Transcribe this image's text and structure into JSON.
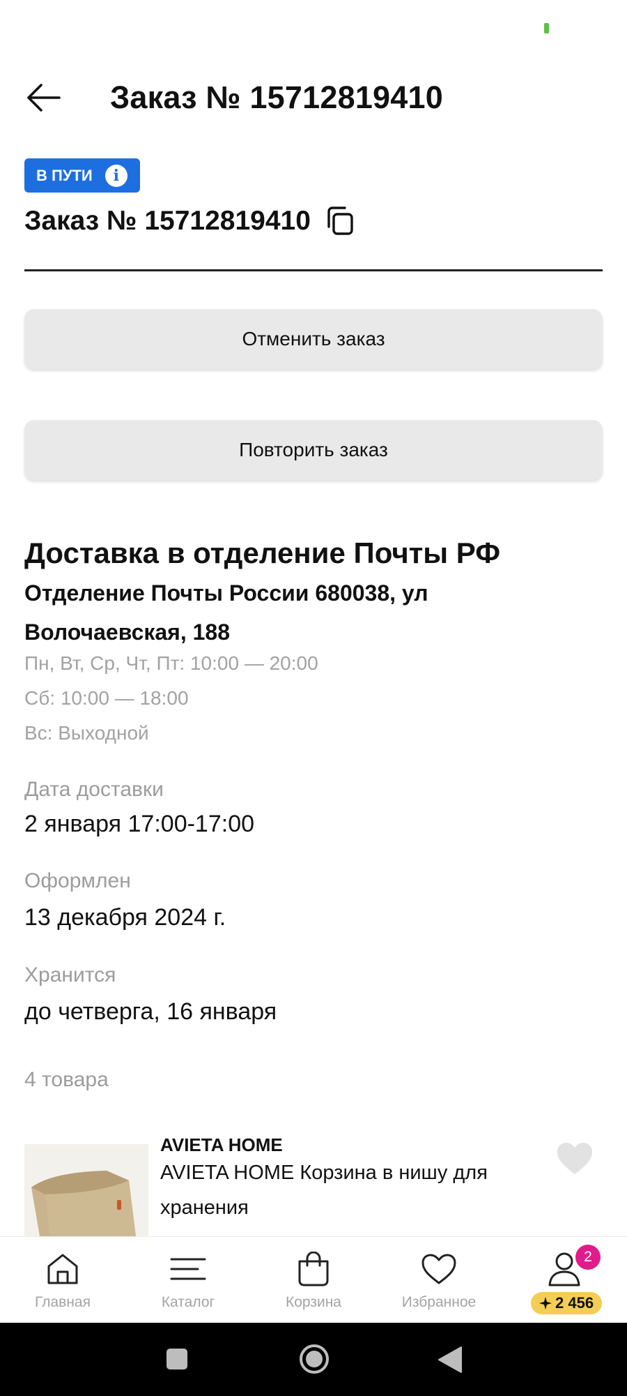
{
  "header": {
    "title": "Заказ № 15712819410"
  },
  "status_badge": {
    "label": "В ПУТИ",
    "info_glyph": "i",
    "color": "#1d6fe0"
  },
  "order": {
    "number_line": "Заказ № 15712819410"
  },
  "actions": {
    "cancel_label": "Отменить заказ",
    "repeat_label": "Повторить заказ"
  },
  "delivery": {
    "title": "Доставка в отделение Почты РФ",
    "address": "Отделение Почты России 680038, ул Волочаевская, 188",
    "hours": [
      "Пн, Вт, Ср, Чт, Пт: 10:00 — 20:00",
      "Сб: 10:00 — 18:00",
      "Вс: Выходной"
    ]
  },
  "details": {
    "delivery_date_label": "Дата доставки",
    "delivery_date_value": "2 января 17:00-17:00",
    "placed_label": "Оформлен",
    "placed_value": "13 декабря 2024 г.",
    "stored_label": "Хранится",
    "stored_value": "до четверга, 16 января"
  },
  "items": {
    "count_label": "4 товара",
    "list": [
      {
        "brand": "AVIETA HOME",
        "name": "AVIETA HOME Корзина в нишу для хранения"
      }
    ]
  },
  "bottom_nav": {
    "items": [
      {
        "label": "Главная",
        "icon": "home-icon"
      },
      {
        "label": "Каталог",
        "icon": "catalog-icon"
      },
      {
        "label": "Корзина",
        "icon": "cart-icon"
      },
      {
        "label": "Избранное",
        "icon": "heart-icon"
      },
      {
        "label": "",
        "icon": "profile-icon"
      }
    ],
    "profile_badge": "2",
    "points": "2 456"
  },
  "colors": {
    "accent": "#1d6fe0",
    "badge_pink": "#e01c8a",
    "points_yellow": "#f4cd55"
  }
}
